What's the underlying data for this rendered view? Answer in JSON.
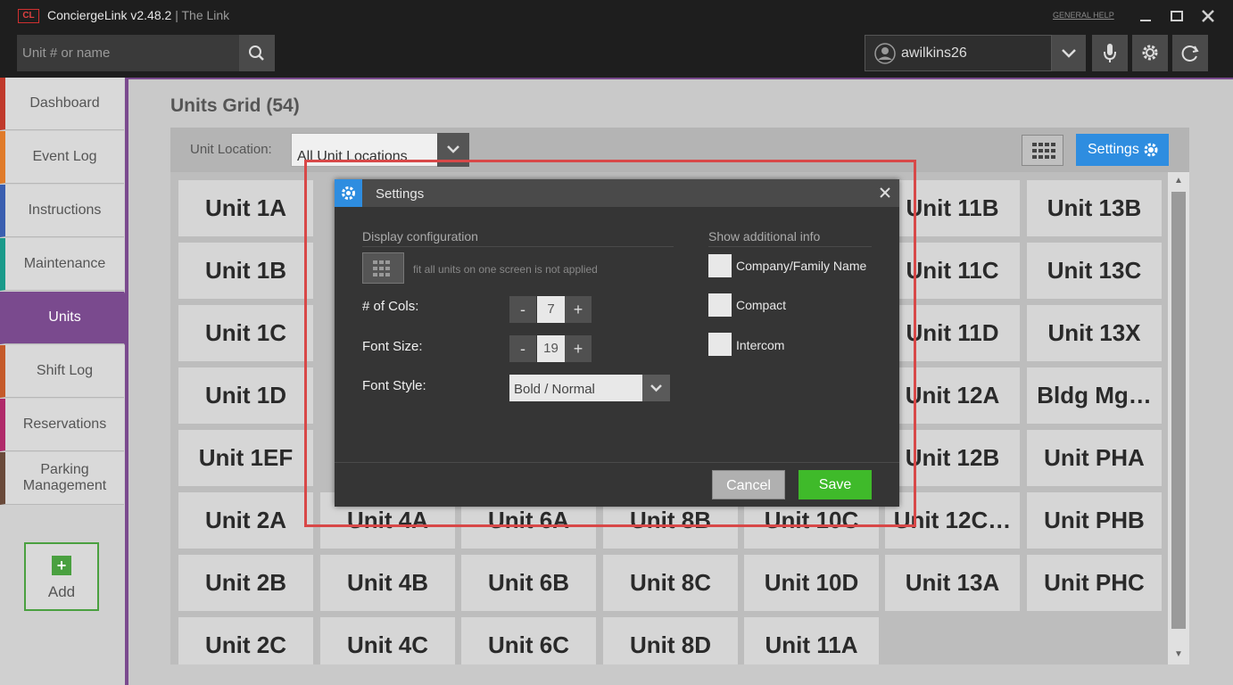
{
  "app": {
    "logo_text": "CL",
    "title": "ConciergeLink v2.48.2",
    "separator": " | ",
    "subtitle": "The Link",
    "help_link": "GENERAL HELP"
  },
  "topbar": {
    "search_placeholder": "Unit # or name",
    "username": "awilkins26"
  },
  "sidebar": {
    "items": [
      {
        "label": "Dashboard",
        "color": "#c0392b"
      },
      {
        "label": "Event Log",
        "color": "#e07b2a"
      },
      {
        "label": "Instructions",
        "color": "#3a5fb0"
      },
      {
        "label": "Maintenance",
        "color": "#1a9a8a"
      },
      {
        "label": "Units",
        "color": "#7a4a8e"
      },
      {
        "label": "Shift Log",
        "color": "#c55a2a"
      },
      {
        "label": "Reservations",
        "color": "#b02a6a"
      },
      {
        "label": "Parking Management",
        "color": "#6a4a3a"
      }
    ],
    "add_label": "Add"
  },
  "main": {
    "title": "Units Grid (54)",
    "location_label": "Unit Location:",
    "location_value": "All Unit Locations",
    "settings_label": "Settings",
    "units": [
      "Unit 1A",
      "",
      "",
      "",
      "",
      "Unit 11B",
      "Unit 13B",
      "Unit 1B",
      "",
      "",
      "",
      "",
      "Unit 11C",
      "Unit 13C",
      "Unit 1C",
      "",
      "",
      "",
      "",
      "Unit 11D",
      "Unit 13X",
      "Unit 1D",
      "",
      "",
      "",
      "",
      "Unit 12A",
      "Bldg Mg…",
      "Unit 1EF",
      "",
      "",
      "",
      "",
      "Unit 12B",
      "Unit PHA",
      "Unit 2A",
      "Unit 4A",
      "Unit 6A",
      "Unit 8B",
      "Unit 10C",
      "Unit 12C…",
      "Unit PHB",
      "Unit 2B",
      "Unit 4B",
      "Unit 6B",
      "Unit 8C",
      "Unit 10D",
      "Unit 13A",
      "Unit PHC",
      "Unit 2C",
      "Unit 4C",
      "Unit 6C",
      "Unit 8D",
      "Unit 11A",
      "",
      ""
    ]
  },
  "dialog": {
    "title": "Settings",
    "display_config_header": "Display configuration",
    "fit_note": "fit all units on one screen is not applied",
    "cols_label": "# of Cols:",
    "cols_value": "7",
    "font_size_label": "Font Size:",
    "font_size_value": "19",
    "font_style_label": "Font Style:",
    "font_style_value": "Bold / Normal",
    "minus": "-",
    "plus": "+",
    "additional_header": "Show additional info",
    "checkboxes": [
      {
        "label": "Company/Family Name",
        "checked": false
      },
      {
        "label": "Compact",
        "checked": false
      },
      {
        "label": "Intercom",
        "checked": false
      }
    ],
    "cancel_label": "Cancel",
    "save_label": "Save"
  }
}
